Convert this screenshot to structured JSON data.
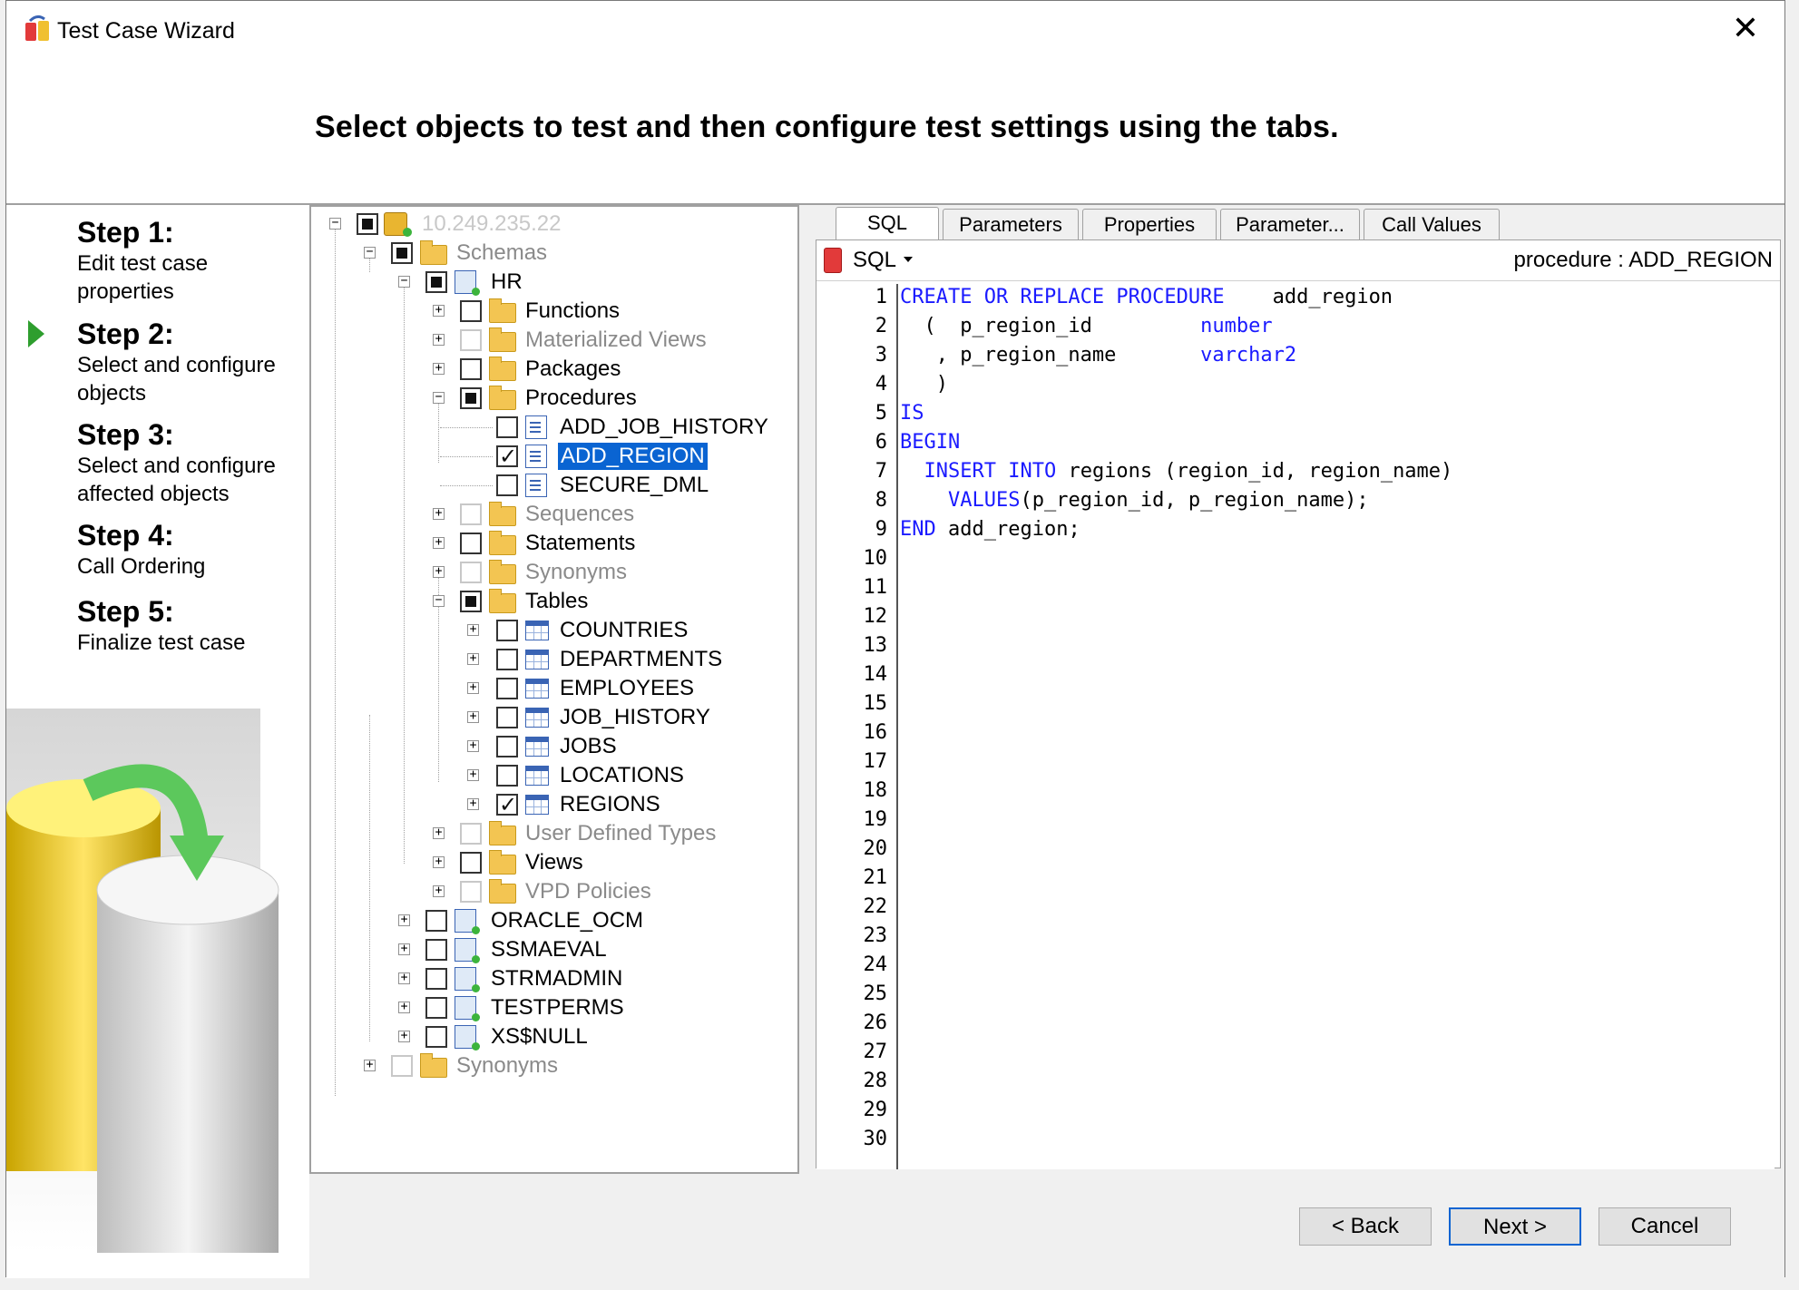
{
  "window": {
    "title": "Test Case Wizard"
  },
  "header": {
    "instruction": "Select objects to test and then configure test settings using the tabs."
  },
  "steps": [
    {
      "title": "Step 1:",
      "desc": "Edit test case properties"
    },
    {
      "title": "Step 2:",
      "desc": "Select and configure objects",
      "current": true
    },
    {
      "title": "Step 3:",
      "desc": "Select and configure affected objects"
    },
    {
      "title": "Step 4:",
      "desc": "Call Ordering"
    },
    {
      "title": "Step 5:",
      "desc": "Finalize test case"
    }
  ],
  "tree": {
    "server": "10.249.235.22",
    "schemas_label": "Schemas",
    "hr": "HR",
    "folders": {
      "functions": "Functions",
      "materialized_views": "Materialized Views",
      "packages": "Packages",
      "procedures": "Procedures",
      "sequences": "Sequences",
      "statements": "Statements",
      "synonyms": "Synonyms",
      "tables": "Tables",
      "user_defined_types": "User Defined Types",
      "views": "Views",
      "vpd_policies": "VPD Policies"
    },
    "procedures": [
      "ADD_JOB_HISTORY",
      "ADD_REGION",
      "SECURE_DML"
    ],
    "selected_procedure": "ADD_REGION",
    "tables": [
      "COUNTRIES",
      "DEPARTMENTS",
      "EMPLOYEES",
      "JOB_HISTORY",
      "JOBS",
      "LOCATIONS",
      "REGIONS"
    ],
    "checked_table": "REGIONS",
    "other_schemas": [
      "ORACLE_OCM",
      "SSMAEVAL",
      "STRMADMIN",
      "TESTPERMS",
      "XS$NULL"
    ],
    "root_synonyms": "Synonyms"
  },
  "tabs": [
    "SQL",
    "Parameters",
    "Properties",
    "Parameter...",
    "Call Values"
  ],
  "active_tab": "SQL",
  "editor": {
    "mode_label": "SQL",
    "object_label": "procedure : ADD_REGION",
    "line_numbers": [
      "1",
      "2",
      "3",
      "4",
      "5",
      "6",
      "7",
      "8",
      "9",
      "10",
      "11",
      "12",
      "13",
      "14",
      "15",
      "16",
      "17",
      "18",
      "19",
      "20",
      "21",
      "22",
      "23",
      "24",
      "25",
      "26",
      "27",
      "28",
      "29",
      "30"
    ]
  },
  "buttons": {
    "back": "< Back",
    "next": "Next >",
    "cancel": "Cancel"
  },
  "colors": {
    "keyword": "#1a1aff",
    "selection": "#0a64d2",
    "current_step_arrow": "#2e9e2e"
  }
}
